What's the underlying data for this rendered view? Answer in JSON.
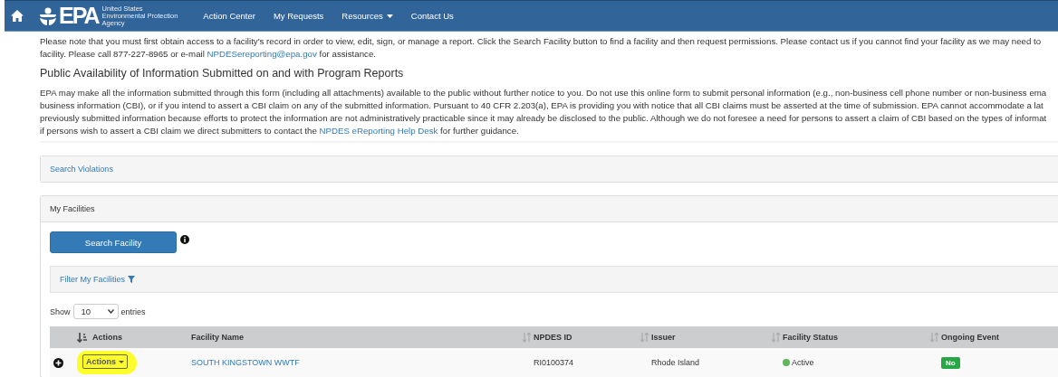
{
  "navbar": {
    "logo": {
      "mark": "EPA",
      "lines": [
        "United States",
        "Environmental Protection",
        "Agency"
      ]
    },
    "items": [
      {
        "label": "Action Center",
        "dropdown": false
      },
      {
        "label": "My Requests",
        "dropdown": false
      },
      {
        "label": "Resources",
        "dropdown": true
      },
      {
        "label": "Contact Us",
        "dropdown": false
      }
    ]
  },
  "notice": {
    "lines": [
      [
        {
          "text": "Please note that you must first obtain access to a facility's record in order to view, edit, sign, or manage a report. Click the Search Facility button to find a facility and then request permissions. Please contact us if you cannot find your facility as we may need to"
        }
      ],
      [
        {
          "text": "facility. Please call 877-227-8965 or e-mail "
        },
        {
          "text": "NPDESereporting@epa.gov",
          "link": true
        },
        {
          "text": " for assistance."
        }
      ]
    ]
  },
  "public_availability": {
    "heading": "Public Availability of Information Submitted on and with Program Reports",
    "lines": [
      [
        {
          "text": "EPA may make all the information submitted through this form (including all attachments) available to the public without further notice to you. Do not use this online form to submit personal information (e.g., non-business cell phone number or non-business ema"
        }
      ],
      [
        {
          "text": "business information (CBI), or if you intend to assert a CBI claim on any of the submitted information. Pursuant to 40 CFR 2.203(a), EPA is providing you with notice that all CBI claims must be asserted at the time of submission. EPA cannot accommodate a lat"
        }
      ],
      [
        {
          "text": "previously submitted information because efforts to protect the information are not administratively practicable since it may already be disclosed to the public. Although we do not foresee a need for persons to assert a claim of CBI based on the types of informat"
        }
      ],
      [
        {
          "text": "if persons wish to assert a CBI claim we direct submitters to contact the "
        },
        {
          "text": "NPDES eReporting Help Desk",
          "link": true
        },
        {
          "text": " for further guidance."
        }
      ]
    ]
  },
  "search_violations": {
    "title": "Search Violations"
  },
  "my_facilities": {
    "title": "My Facilities",
    "search_button": "Search Facility",
    "filter": {
      "label": "Filter My Facilities"
    },
    "length": {
      "before": "Show",
      "value": "10",
      "after": "entries"
    },
    "table": {
      "columns": [
        {
          "label": "Actions",
          "sortable": true,
          "sorted": true
        },
        {
          "label": "Facility Name",
          "sortable": false,
          "sorted": false
        },
        {
          "label": "NPDES ID",
          "sortable": true,
          "sorted": false
        },
        {
          "label": "Issuer",
          "sortable": true,
          "sorted": false
        },
        {
          "label": "Facility Status",
          "sortable": true,
          "sorted": false
        },
        {
          "label": "Ongoing Event",
          "sortable": true,
          "sorted": false
        }
      ],
      "rows": [
        {
          "action": {
            "label": "Actions",
            "highlighted": true
          },
          "facility_name": "SOUTH KINGSTOWN WWTF",
          "npdes_id": "RI0100374",
          "issuer": "Rhode Island",
          "status": {
            "label": "Active",
            "color": "#5cb85c"
          },
          "ongoing_event": {
            "label": "No",
            "color": "#27a745"
          }
        }
      ]
    }
  }
}
